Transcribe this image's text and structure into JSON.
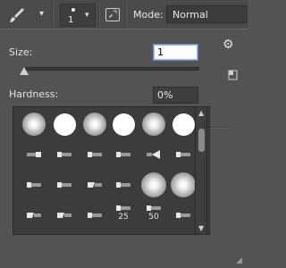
{
  "options_bar": {
    "tool_icon": "brush-icon",
    "brush_size_display": "1",
    "panel_toggle_icon": "brush-panel-toggle-icon",
    "mode_label": "Mode:",
    "mode_value": "Normal"
  },
  "brush_picker": {
    "size_label": "Size:",
    "size_value": "1",
    "size_slider_level": 0,
    "hardness_label": "Hardness:",
    "hardness_value": "0%",
    "hardness_slider_level": 0,
    "settings_icon": "gear-icon",
    "new_preset_icon": "new-preset-icon",
    "tip_labels": {
      "r4c4": "25",
      "r4c5": "50"
    }
  },
  "colors": {
    "panel_bg": "#535353",
    "picker_bg": "#3c3c3c",
    "active_field_border": "#6a8fd0"
  }
}
